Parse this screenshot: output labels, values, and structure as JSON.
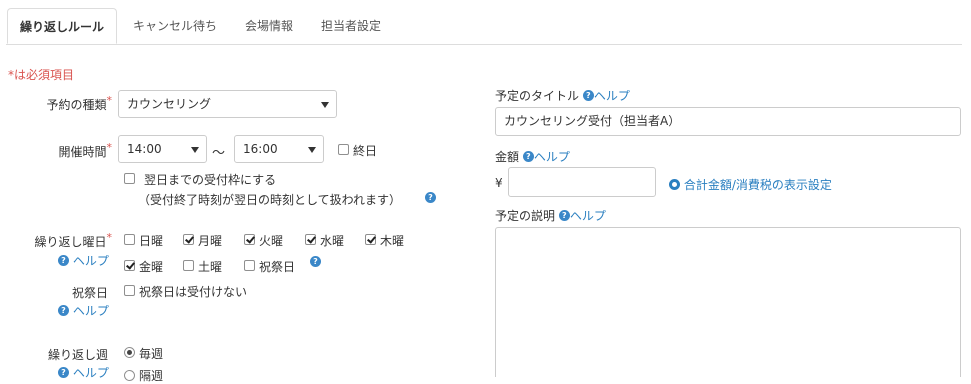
{
  "tabs": [
    {
      "label": "繰り返しルール",
      "active": true
    },
    {
      "label": "キャンセル待ち"
    },
    {
      "label": "会場情報"
    },
    {
      "label": "担当者設定"
    }
  ],
  "required_note": "*は必須項目",
  "required_mark": "*",
  "reservation_type": {
    "label": "予約の種類",
    "value": "カウンセリング"
  },
  "hours": {
    "label": "開催時間",
    "start": "14:00",
    "separator": "〜",
    "end": "16:00",
    "all_day_label": "終日",
    "next_day_label": "翌日までの受付枠にする",
    "next_day_note": "（受付終了時刻が翌日の時刻として扱われます）"
  },
  "help_text": "ヘルプ",
  "weekdays": {
    "label": "繰り返し曜日",
    "days": [
      {
        "label": "日曜",
        "checked": false
      },
      {
        "label": "月曜",
        "checked": true
      },
      {
        "label": "火曜",
        "checked": true
      },
      {
        "label": "水曜",
        "checked": true
      },
      {
        "label": "木曜",
        "checked": true
      },
      {
        "label": "金曜",
        "checked": true
      },
      {
        "label": "土曜",
        "checked": false
      },
      {
        "label": "祝祭日",
        "checked": false
      }
    ]
  },
  "holiday": {
    "label": "祝祭日",
    "option_label": "祝祭日は受付けない"
  },
  "repeat_week": {
    "label": "繰り返し週",
    "options": [
      {
        "label": "毎週",
        "checked": true
      },
      {
        "label": "隔週",
        "checked": false
      }
    ]
  },
  "event_title": {
    "label": "予定のタイトル",
    "value": "カウンセリング受付（担当者A）"
  },
  "amount": {
    "label": "金額",
    "currency": "¥",
    "value": "",
    "settings_link": "合計金額/消費税の表示設定"
  },
  "description": {
    "label": "予定の説明",
    "value": ""
  },
  "colors": {
    "accent": "#2a7fc0",
    "required": "#d9534f",
    "border": "#cccccc"
  }
}
